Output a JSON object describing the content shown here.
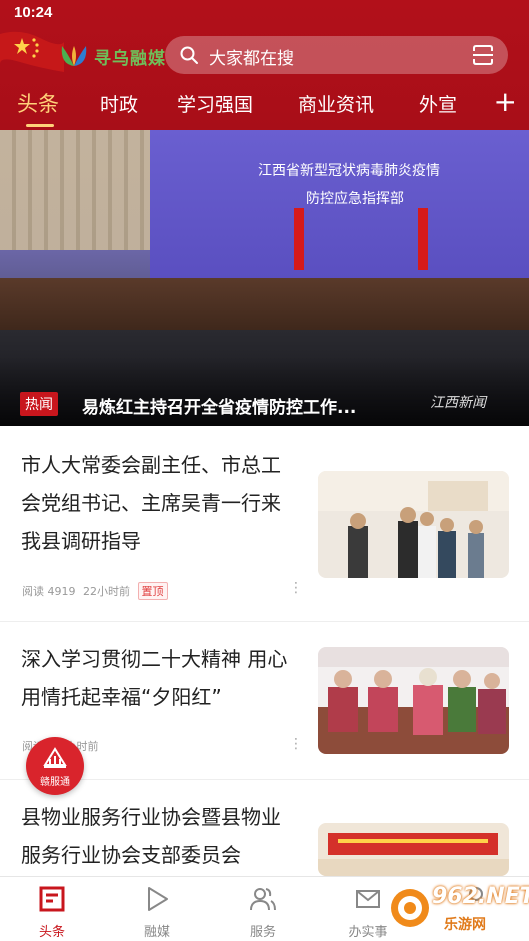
{
  "status_bar": {
    "time": "10:24"
  },
  "header": {
    "logo_text": "寻乌融媒",
    "search_placeholder": "大家都在搜",
    "tabs": [
      {
        "label": "头条",
        "active": true
      },
      {
        "label": "时政",
        "active": false
      },
      {
        "label": "学习强国",
        "active": false
      },
      {
        "label": "商业资讯",
        "active": false
      },
      {
        "label": "外宣",
        "active": false
      }
    ],
    "add_tab_label": "+"
  },
  "banner": {
    "screen_line1": "江西省新型冠状病毒肺炎疫情",
    "screen_line2": "防控应急指挥部",
    "badge": "热闻",
    "title": "易炼红主持召开全省疫情防控工作...",
    "watermark": "江西新闻"
  },
  "news": [
    {
      "title": "市人大常委会副主任、市总工会党组书记、主席吴青一行来我县调研指导",
      "reads": "阅读 4919",
      "time": "22小时前",
      "pin": "置顶"
    },
    {
      "title": "深入学习贯彻二十大精神 用心用情托起幸福“夕阳红”",
      "reads": "阅读",
      "time": "19小时前",
      "pin": ""
    },
    {
      "title": "县物业服务行业协会暨县物业服务行业协会支部委员会",
      "reads": "",
      "time": "",
      "pin": ""
    }
  ],
  "float_badge": {
    "label": "赣服通"
  },
  "bottom_nav": [
    {
      "label": "头条",
      "icon": "news-icon",
      "active": true
    },
    {
      "label": "融媒",
      "icon": "play-icon",
      "active": false
    },
    {
      "label": "服务",
      "icon": "users-icon",
      "active": false
    },
    {
      "label": "办实事",
      "icon": "mail-icon",
      "active": false
    },
    {
      "label": "",
      "icon": "profile-icon",
      "active": false
    }
  ],
  "site_watermark": {
    "main": "962.NET",
    "sub": "乐游网"
  },
  "colors": {
    "brand_red": "#b2101a",
    "active_tab": "#ffd27a"
  }
}
